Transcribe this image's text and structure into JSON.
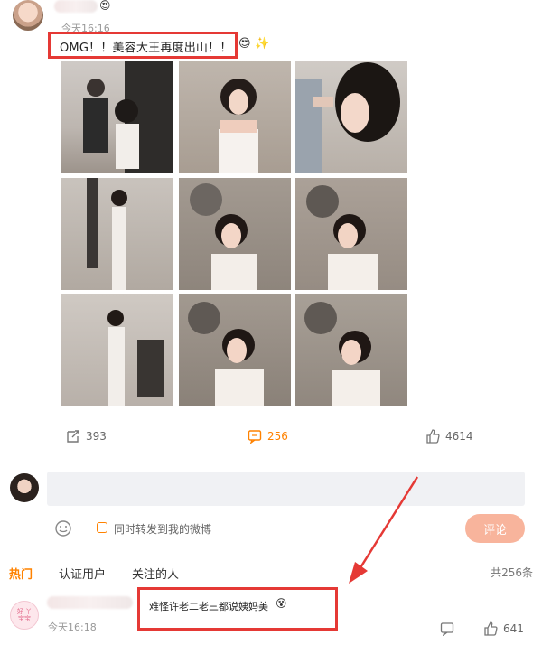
{
  "post": {
    "time": "今天16:16",
    "text": "OMG！！美容大王再度出山！！",
    "emoji_1": "😍",
    "emoji_2": "✨",
    "actions": {
      "repost_count": "393",
      "comment_count": "256",
      "like_count": "4614"
    }
  },
  "composer": {
    "input_placeholder": "",
    "repost_label": "同时转发到我的微博",
    "submit_label": "评论"
  },
  "comments_header": {
    "tabs": [
      "热门",
      "认证用户",
      "关注的人"
    ],
    "total": "共256条"
  },
  "top_comment": {
    "avatar_text": "好 丫\n宝宝",
    "text": "难怪许老二老三都说姨妈美",
    "emoji": "😵",
    "time": "今天16:18",
    "like_count": "641"
  },
  "colors": {
    "accent_orange": "#ff8200",
    "highlight_red": "#e53935",
    "submit_button": "#f8b49c"
  }
}
